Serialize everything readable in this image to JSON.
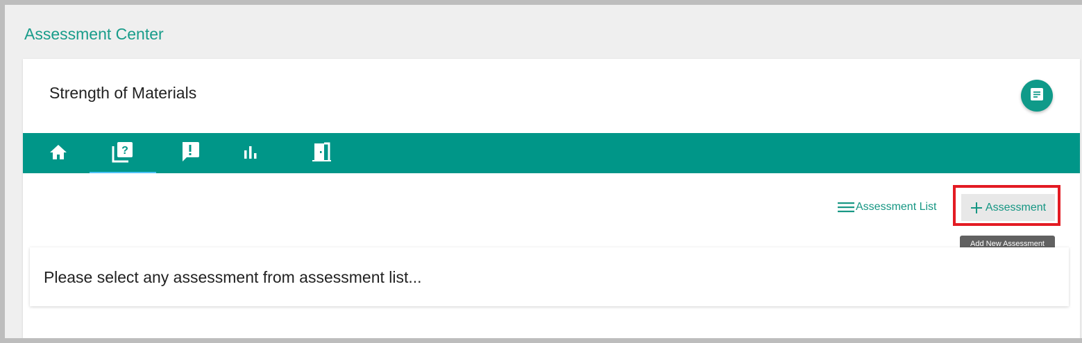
{
  "header": {
    "title": "Assessment Center"
  },
  "course": {
    "title": "Strength of Materials",
    "menu_icon": "notes-icon"
  },
  "tabs": [
    {
      "name": "home",
      "icon": "home-icon",
      "active": false
    },
    {
      "name": "assessments",
      "icon": "question-library-icon",
      "active": true
    },
    {
      "name": "feedback",
      "icon": "feedback-icon",
      "active": false
    },
    {
      "name": "reports",
      "icon": "bar-chart-icon",
      "active": false
    },
    {
      "name": "exit",
      "icon": "exit-door-icon",
      "active": false
    }
  ],
  "toolbar": {
    "list_label": "Assessment List",
    "list_icon": "list-icon",
    "add_label": "Assessment",
    "add_icon": "plus-icon",
    "add_tooltip": "Add New Assessment"
  },
  "message": {
    "text": "Please select any assessment from assessment list..."
  },
  "colors": {
    "accent": "#009688",
    "link": "#159683",
    "highlight": "#e31b23",
    "tooltip": "#616161"
  }
}
